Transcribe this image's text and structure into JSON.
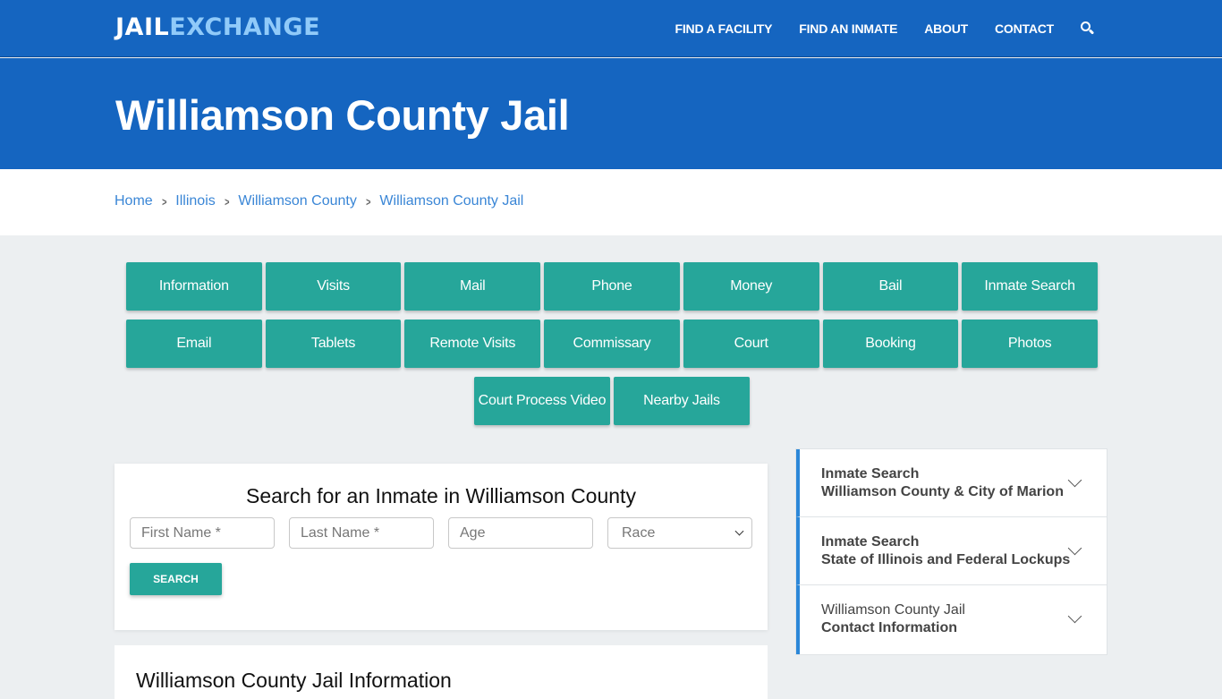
{
  "brand": {
    "part1": "JAIL",
    "part2": "EXCHANGE"
  },
  "nav": {
    "items": [
      "FIND A FACILITY",
      "FIND AN INMATE",
      "ABOUT",
      "CONTACT"
    ],
    "search_icon": "search-icon"
  },
  "hero": {
    "title": "Williamson County Jail"
  },
  "breadcrumb": {
    "items": [
      "Home",
      "Illinois",
      "Williamson County",
      "Williamson County Jail"
    ],
    "separator": "chevron-right-icon"
  },
  "topic_buttons": {
    "row1": [
      "Information",
      "Visits",
      "Mail",
      "Phone",
      "Money",
      "Bail",
      "Inmate Search"
    ],
    "row2": [
      "Email",
      "Tablets",
      "Remote Visits",
      "Commissary",
      "Court",
      "Booking",
      "Photos"
    ],
    "row3": [
      "Court Process Video",
      "Nearby Jails"
    ]
  },
  "search_form": {
    "title": "Search for an Inmate in Williamson County",
    "first_name_placeholder": "First Name *",
    "last_name_placeholder": "Last Name *",
    "age_placeholder": "Age",
    "race_selected": "Race",
    "submit_label": "SEARCH"
  },
  "info_section": {
    "title": "Williamson County Jail Information"
  },
  "sidebar": {
    "items": [
      {
        "line1": "Inmate Search",
        "line2": "Williamson County & City of Marion"
      },
      {
        "line1": "Inmate Search",
        "line2": "State of Illinois and Federal Lockups"
      },
      {
        "line1": "Williamson County Jail",
        "line2": "Contact Information"
      }
    ]
  },
  "colors": {
    "header_blue": "#1565c0",
    "logo_accent": "#90caf9",
    "button_teal": "#26a69a",
    "link_blue": "#3a86d6",
    "accordion_accent": "#2b87d8",
    "page_bg": "#eceff1"
  }
}
